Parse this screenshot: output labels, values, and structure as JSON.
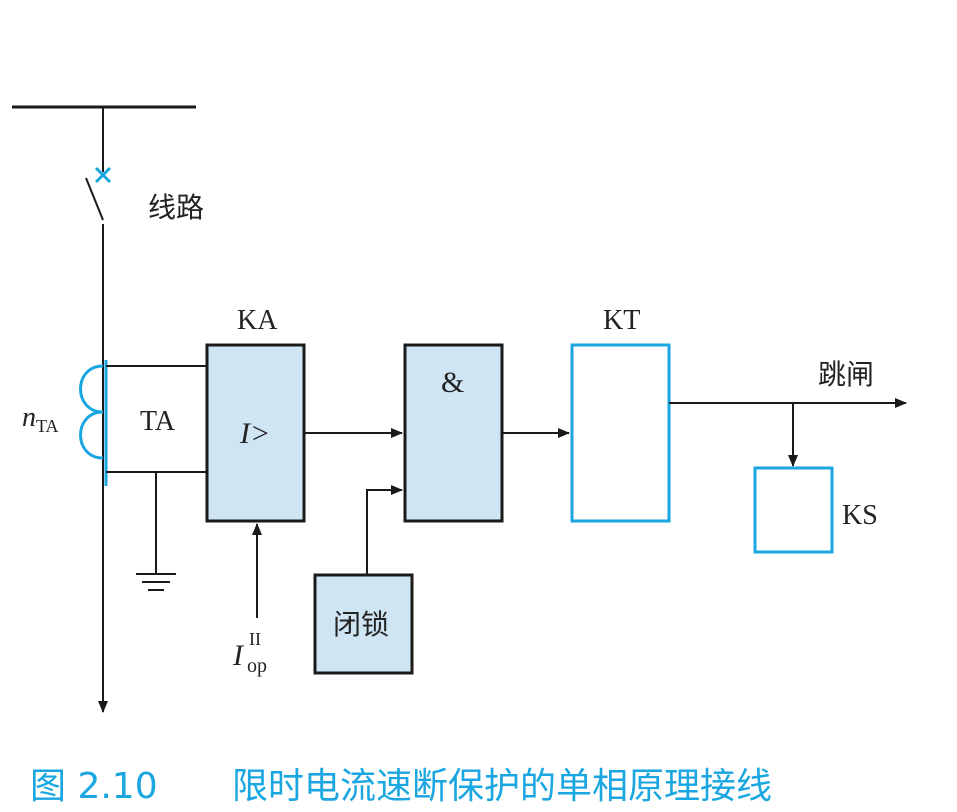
{
  "colors": {
    "line": "#1a1a1a",
    "accent": "#1aa6e0",
    "box_fill": "#cfe5f4",
    "caption": "#1aa6e0"
  },
  "labels": {
    "line": "线路",
    "ka": "KA",
    "kt": "KT",
    "trip": "跳闸",
    "ks": "KS",
    "n_main": "n",
    "n_sub": "TA",
    "ta": "TA",
    "i_gt": "I>",
    "and_gate": "&",
    "lock": "闭锁",
    "iop_main": "I",
    "iop_sup": "II",
    "iop_sub": "op"
  },
  "caption": {
    "figure_no": "图 2.10",
    "title": "限时电流速断保护的单相原理接线"
  }
}
